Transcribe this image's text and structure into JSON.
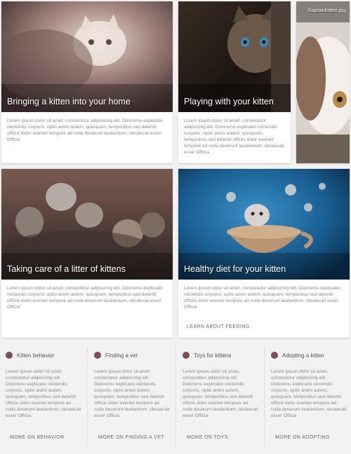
{
  "cards": {
    "kitten_home": {
      "title": "Bringing a kitten into your home",
      "body": "Lorem ipsum dolor sit amet, consectetur adipisicing elit. Doloremu explicabo reiciendis corporis, optio animi autem, quisquam, temporibus sed deleniti officiis dolor eveniet tempore ad nulla deserunt laudantium, obcaecati esse! Officia"
    },
    "playing": {
      "title": "Playing with your kitten",
      "body": "Lorem ipsum dolor sit amet, consectetur adipisicing elit. Doloremu explicabo reiciendis corporis, optio animi autem, quisquam, temporibus sed deleniti officiis dolor eveniet tempore ad nulla deserunt laudantium, obcaecati esse! Officia"
    },
    "side_image": {
      "filename": "KaptainKitten.jpg"
    },
    "litter": {
      "title": "Taking care of a litter of kittens",
      "body": "Lorem ipsum dolor sit amet, consectetur adipisicing elit. Doloremu explicabo reiciendis corporis, optio animi autem, quisquam, temporibus sed deleniti officiis dolor eveniet tempore ad nulla deserunt laudantium, obcaecati esse! Officia"
    },
    "diet": {
      "title": "Healthy diet for your kitten",
      "body": "Lorem ipsum dolor sit amet, consectetur adipisicing elit. Doloremu explicabo reiciendis corporis, optio animi autem, quisquam, temporibus sed deleniti officiis dolor eveniet tempore ad nulla deserunt laudantium, obcaecati esse! Officia",
      "action": "LEARN ABOUT FEEDING"
    }
  },
  "small_cards": [
    {
      "title": "Kitten behavior",
      "body": "Lorem ipsum dolor sit amet, consectetur adipisicing elit. Doloremu explicabo reiciendis corporis, optio animi autem, quisquam, temporibus sed deleniti officiis dolor eveniet tempore ad nulla deserunt laudantium, obcaecati esse! Officia",
      "action": "MORE ON BEHAVIOR"
    },
    {
      "title": "Finding a vet",
      "body": "Lorem ipsum dolor sit amet, consectetur adipisicing elit. Doloremu explicabo reiciendis corporis, optio animi autem, quisquam, temporibus sed deleniti officiis dolor eveniet tempore ad nulla deserunt laudantium, obcaecati esse! Officia",
      "action": "MORE ON FINDING A VET"
    },
    {
      "title": "Toys for kittens",
      "body": "Lorem ipsum dolor sit amet, consectetur adipisicing elit. Doloremu explicabo reiciendis corporis, optio animi autem, quisquam, temporibus sed deleniti officiis dolor eveniet tempore ad nulla deserunt laudantium, obcaecati esse! Officia",
      "action": "MORE ON TOYS"
    },
    {
      "title": "Adopting a kitten",
      "body": "Lorem ipsum dolor sit amet, consectetur adipisicing elit. Doloremu explicabo reiciendis corporis, optio animi autem, quisquam, temporibus sed deleniti officiis dolor eveniet tempore ad nulla deserunt laudantium, obcaecati esse! Officia",
      "action": "MORE ON ADOPTING"
    }
  ]
}
